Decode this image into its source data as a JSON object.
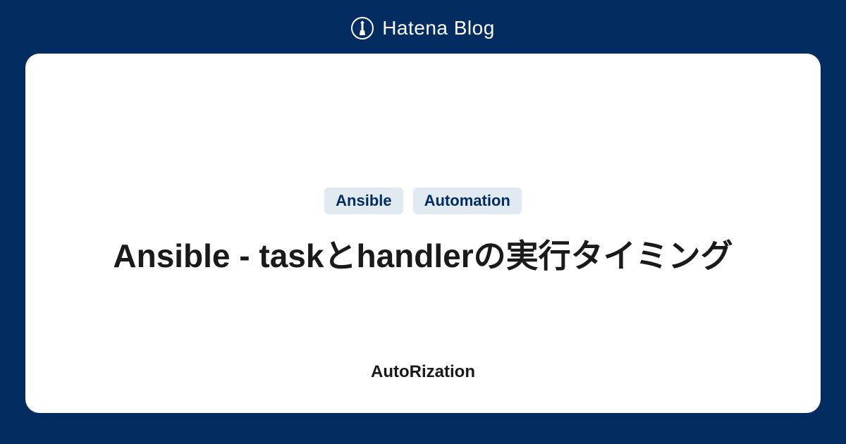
{
  "header": {
    "brand": "Hatena Blog"
  },
  "card": {
    "tags": [
      "Ansible",
      "Automation"
    ],
    "title": "Ansible - taskとhandlerの実行タイミング",
    "author": "AutoRization"
  },
  "colors": {
    "background": "#032d61",
    "cardBackground": "#ffffff",
    "tagBackground": "#e1e9f1",
    "tagText": "#032d61"
  }
}
